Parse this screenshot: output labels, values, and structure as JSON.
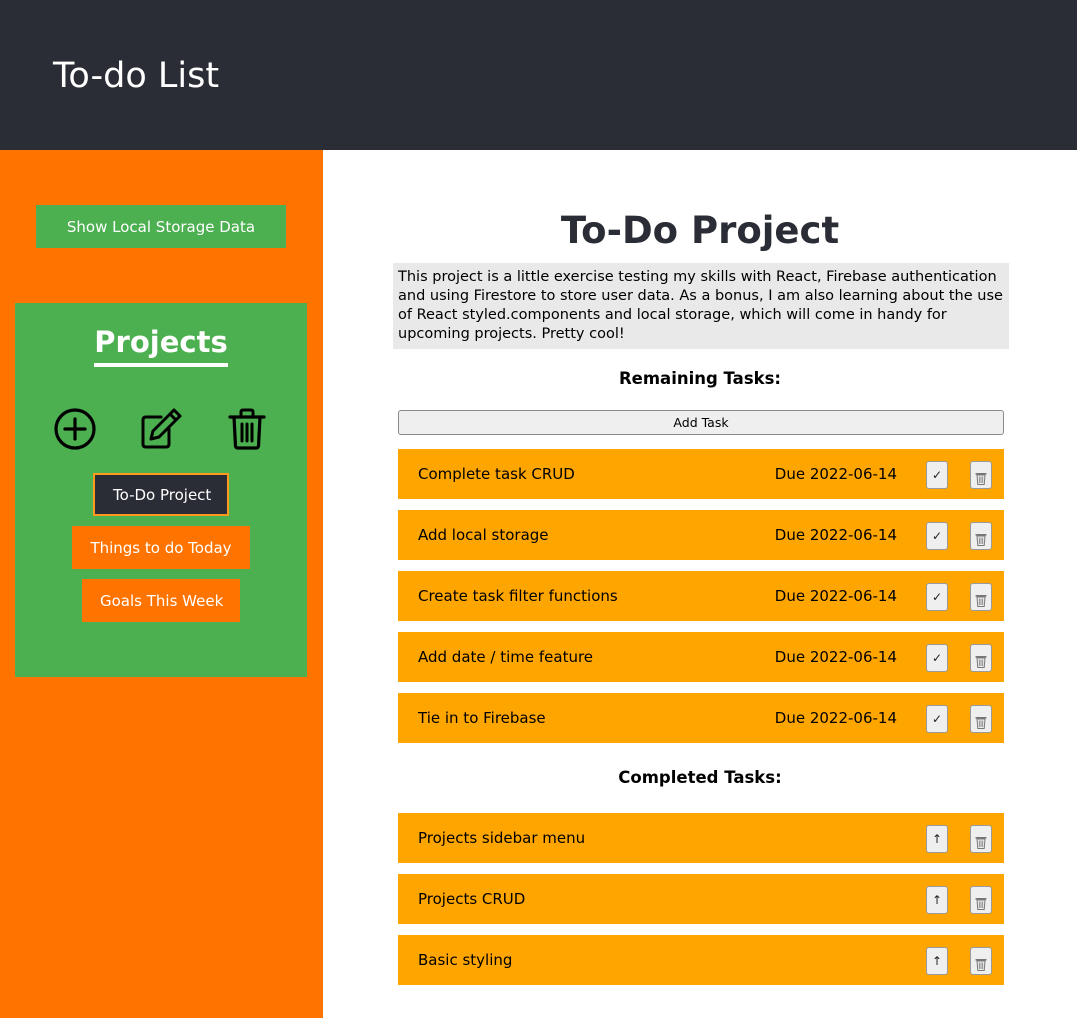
{
  "header": {
    "title": "To-do List"
  },
  "sidebar": {
    "local_storage_button": "Show Local Storage Data",
    "projects_title": "Projects",
    "icons": {
      "add": "add-circle-icon",
      "edit": "edit-icon",
      "delete": "trash-icon"
    },
    "projects": [
      {
        "label": "To-Do Project",
        "active": true
      },
      {
        "label": "Things to do Today",
        "active": false
      },
      {
        "label": "Goals This Week",
        "active": false
      }
    ]
  },
  "main": {
    "project_title": "To-Do Project",
    "description": "This project is a little exercise testing my skills with React, Firebase authentication and using Firestore to store user data. As a bonus, I am also learning about the use of React styled.components and local storage, which will come in handy for upcoming projects. Pretty cool!",
    "remaining_heading": "Remaining Tasks:",
    "add_task_label": "Add Task",
    "remaining_tasks": [
      {
        "name": "Complete task CRUD",
        "due": "Due 2022-06-14",
        "complete_icon": "✓"
      },
      {
        "name": "Add local storage",
        "due": "Due 2022-06-14",
        "complete_icon": "✓"
      },
      {
        "name": "Create task filter functions",
        "due": "Due 2022-06-14",
        "complete_icon": "✓"
      },
      {
        "name": "Add date / time feature",
        "due": "Due 2022-06-14",
        "complete_icon": "✓"
      },
      {
        "name": "Tie in to Firebase",
        "due": "Due 2022-06-14",
        "complete_icon": "✓"
      }
    ],
    "completed_heading": "Completed Tasks:",
    "completed_tasks": [
      {
        "name": "Projects sidebar menu",
        "restore_icon": "↑"
      },
      {
        "name": "Projects CRUD",
        "restore_icon": "↑"
      },
      {
        "name": "Basic styling",
        "restore_icon": "↑"
      }
    ]
  },
  "colors": {
    "header_bg": "#2a2d35",
    "sidebar_bg": "#ff7400",
    "panel_bg": "#4caf50",
    "task_bg": "#ffa500",
    "active_project_bg": "#2a2d35"
  }
}
